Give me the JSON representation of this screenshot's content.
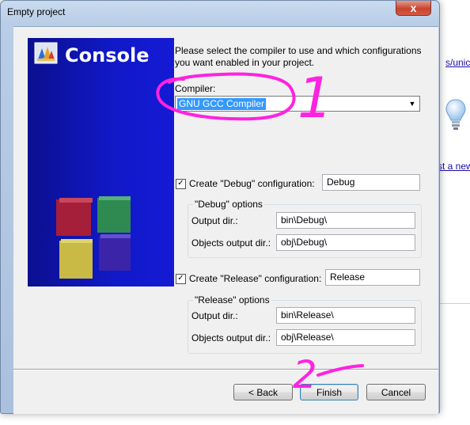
{
  "background": {
    "link_1": "s/unico",
    "link_2": "st a new"
  },
  "window": {
    "title": "Empty project",
    "close_glyph": "x"
  },
  "banner": {
    "title": "Console",
    "logo_icon": "codeblocks-logo-icon"
  },
  "wizard": {
    "description": "Please select the compiler to use and which configurations you want enabled in your project.",
    "compiler_label": "Compiler:",
    "compiler_value": "GNU GCC Compiler",
    "debug": {
      "checkbox_label": "Create \"Debug\" configuration:",
      "checked": true,
      "name": "Debug",
      "group_title": "\"Debug\" options",
      "output_label": "Output dir.:",
      "output_value": "bin\\Debug\\",
      "objects_label": "Objects output dir.:",
      "objects_value": "obj\\Debug\\"
    },
    "release": {
      "checkbox_label": "Create \"Release\" configuration:",
      "checked": true,
      "name": "Release",
      "group_title": "\"Release\" options",
      "output_label": "Output dir.:",
      "output_value": "bin\\Release\\",
      "objects_label": "Objects output dir.:",
      "objects_value": "obj\\Release\\"
    }
  },
  "buttons": {
    "back": "< Back",
    "finish": "Finish",
    "cancel": "Cancel"
  },
  "annotations": {
    "mark_1": "1",
    "mark_2": "2",
    "color": "#ff22e0"
  },
  "colors": {
    "banner_blue": "#1119c9",
    "selection": "#3399ff"
  }
}
